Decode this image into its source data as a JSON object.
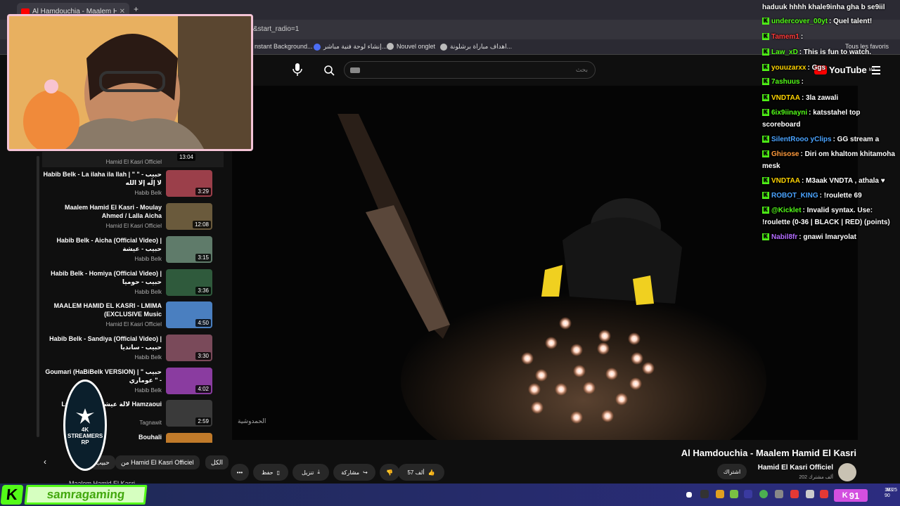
{
  "browser": {
    "tab_title": "Al Hamdouchia - Maalem H",
    "url_fragment": "&start_radio=1",
    "bookmarks": [
      "nstant Background...",
      "إنشاء لوحة فنية مباشر...",
      "Nouvel onglet",
      "اهداف مباراة برشلونة...",
      "Tous les favoris"
    ]
  },
  "youtube": {
    "search_placeholder": "بحث",
    "logo": "YouTube",
    "logo_region": "MA",
    "video_watermark": "الحمدوشية",
    "video_title": "Al Hamdouchia - Maalem Hamid El Kasri",
    "channel_name": "Hamid El Kasri Officiel",
    "subscribers": "202 ألف مشترك",
    "subscribe_label": "اشتراك",
    "actions": {
      "like_count": "57 ألف",
      "share": "مشاركة",
      "download": "تنزيل",
      "save": "حفظ",
      "more": "•••"
    },
    "playlist": [
      {
        "title": "",
        "channel": "Hamid El Kasri Officiel",
        "duration": "13:04"
      },
      {
        "title": "Habib Belk - La ilaha ila llah | \" حبيب - \" لا إلٰه إلا الله",
        "channel": "Habib Belk",
        "duration": "3:29"
      },
      {
        "title": "Maalem Hamid El Kasri - Moulay Ahmed / Lalla Aicha",
        "channel": "Hamid El Kasri Officiel",
        "duration": "12:08"
      },
      {
        "title": "Habib Belk - Aicha (Official Video) | حبيب - عيشة",
        "channel": "Habib Belk",
        "duration": "3:15"
      },
      {
        "title": "Habib Belk - Homiya (Official Video) | حبيب - حوميا",
        "channel": "Habib Belk",
        "duration": "3:36"
      },
      {
        "title": "MAALEM HAMID EL KASRI - LMIMA (EXCLUSIVE Music",
        "channel": "Hamid El Kasri Officiel",
        "duration": "4:50"
      },
      {
        "title": "Habib Belk - Sandiya (Official Video) | حبيب - سانديا",
        "channel": "Habib Belk",
        "duration": "3:30"
      },
      {
        "title": "Goumari (HaBiBelk VERSION) | \" حبيب - \" عوماري",
        "channel": "Habib Belk",
        "duration": "4:02"
      },
      {
        "title": "Lalla Aicha - لالة عيشة Hamzaoui",
        "channel": "Tagnawit",
        "duration": "2:59"
      },
      {
        "title": "Bouhali",
        "channel": "",
        "duration": ""
      }
    ],
    "chips": [
      "الكل",
      "من Hamid El Kasri Officiel",
      "حبيب"
    ],
    "next_label": "Maalem Hamid El Kasri"
  },
  "chat": [
    {
      "user": "",
      "text": "haduuk hhhh khale9inha gha b se9iil",
      "color": "#ffffff"
    },
    {
      "user": "undercover_00yt",
      "text": "Quel talent!",
      "color": "#53fc18"
    },
    {
      "user": "Tamem1",
      "text": "",
      "color": "#ff3b3b"
    },
    {
      "user": "Law_xD",
      "text": "This is fun to watch.",
      "color": "#53fc18"
    },
    {
      "user": "youuzarxx",
      "text": "Ggs",
      "color": "#ffd400"
    },
    {
      "user": "7ashuus",
      "text": "",
      "color": "#53fc18"
    },
    {
      "user": "VNDTAA",
      "text": "3la zawali",
      "color": "#ffd400"
    },
    {
      "user": "6ix9iinayni",
      "text": "katsstahel top scoreboard",
      "color": "#53fc18"
    },
    {
      "user": "SilentRooo yClips",
      "text": "GG stream a",
      "color": "#4aa3ff"
    },
    {
      "user": "Ghisose",
      "text": "Diri om khaltom khitamoha mesk",
      "color": "#ff9a3c"
    },
    {
      "user": "VNDTAA",
      "text": "M3aak VNDTA , athala ♥",
      "color": "#ffd400"
    },
    {
      "user": "ROBOT_KING",
      "text": "!roulette 69",
      "color": "#4aa3ff"
    },
    {
      "user": "@Kicklet",
      "text": "Invalid syntax. Use: !roulette (0-36 | BLACK | RED) (points)",
      "color": "#53fc18"
    },
    {
      "user": "Nabil8fr",
      "text": "gnawi lmaryolat",
      "color": "#b36bff"
    }
  ],
  "stream": {
    "streamer": "samragaming",
    "badge_text": "4K STREAMERS",
    "badge_sub": "RP",
    "viewers": "91",
    "clock_top": "183",
    "clock_bottom": "90",
    "clock_right": "M 25"
  },
  "colors": {
    "kick_green": "#53fc18",
    "youtube_red": "#ff0000",
    "webcam_border": "#f4c4d6"
  }
}
